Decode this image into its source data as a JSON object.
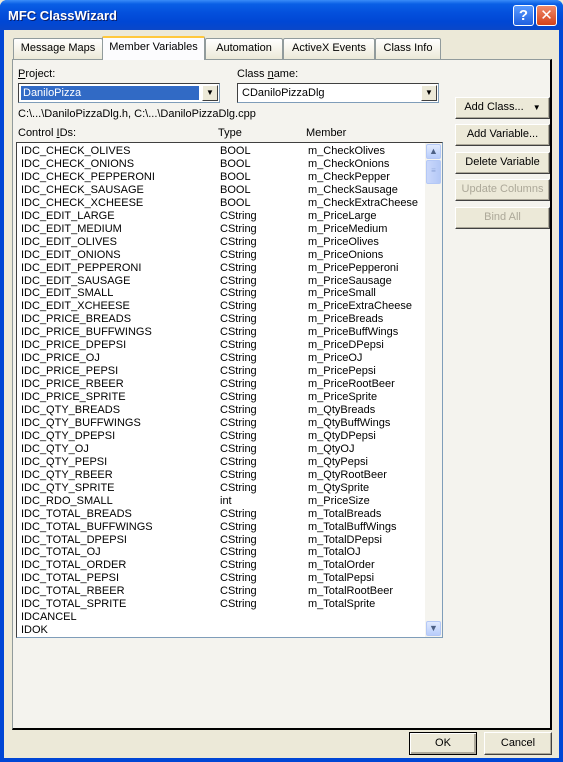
{
  "window": {
    "title": "MFC ClassWizard",
    "help_button": "?",
    "close_button": "✕"
  },
  "tabs": [
    {
      "label": "Message Maps",
      "active": false
    },
    {
      "label": "Member Variables",
      "active": true
    },
    {
      "label": "Automation",
      "active": false
    },
    {
      "label": "ActiveX Events",
      "active": false
    },
    {
      "label": "Class Info",
      "active": false
    }
  ],
  "project": {
    "label_accel": "P",
    "label_rest": "roject:",
    "value": "DaniloPizza"
  },
  "class_name": {
    "label_pre": "Class ",
    "label_accel": "n",
    "label_rest": "ame:",
    "value": "CDaniloPizzaDlg"
  },
  "file_path": "C:\\...\\DaniloPizzaDlg.h, C:\\...\\DaniloPizzaDlg.cpp",
  "list_headers": {
    "control_ids_pre": "Control ",
    "control_ids_accel": "I",
    "control_ids_rest": "Ds:",
    "type": "Type",
    "member": "Member"
  },
  "rows": [
    {
      "id": "IDC_CHECK_OLIVES",
      "type": "BOOL",
      "member": "m_CheckOlives"
    },
    {
      "id": "IDC_CHECK_ONIONS",
      "type": "BOOL",
      "member": "m_CheckOnions"
    },
    {
      "id": "IDC_CHECK_PEPPERONI",
      "type": "BOOL",
      "member": "m_CheckPepper"
    },
    {
      "id": "IDC_CHECK_SAUSAGE",
      "type": "BOOL",
      "member": "m_CheckSausage"
    },
    {
      "id": "IDC_CHECK_XCHEESE",
      "type": "BOOL",
      "member": "m_CheckExtraCheese"
    },
    {
      "id": "IDC_EDIT_LARGE",
      "type": "CString",
      "member": "m_PriceLarge"
    },
    {
      "id": "IDC_EDIT_MEDIUM",
      "type": "CString",
      "member": "m_PriceMedium"
    },
    {
      "id": "IDC_EDIT_OLIVES",
      "type": "CString",
      "member": "m_PriceOlives"
    },
    {
      "id": "IDC_EDIT_ONIONS",
      "type": "CString",
      "member": "m_PriceOnions"
    },
    {
      "id": "IDC_EDIT_PEPPERONI",
      "type": "CString",
      "member": "m_PricePepperoni"
    },
    {
      "id": "IDC_EDIT_SAUSAGE",
      "type": "CString",
      "member": "m_PriceSausage"
    },
    {
      "id": "IDC_EDIT_SMALL",
      "type": "CString",
      "member": "m_PriceSmall"
    },
    {
      "id": "IDC_EDIT_XCHEESE",
      "type": "CString",
      "member": "m_PriceExtraCheese"
    },
    {
      "id": "IDC_PRICE_BREADS",
      "type": "CString",
      "member": "m_PriceBreads"
    },
    {
      "id": "IDC_PRICE_BUFFWINGS",
      "type": "CString",
      "member": "m_PriceBuffWings"
    },
    {
      "id": "IDC_PRICE_DPEPSI",
      "type": "CString",
      "member": "m_PriceDPepsi"
    },
    {
      "id": "IDC_PRICE_OJ",
      "type": "CString",
      "member": "m_PriceOJ"
    },
    {
      "id": "IDC_PRICE_PEPSI",
      "type": "CString",
      "member": "m_PricePepsi"
    },
    {
      "id": "IDC_PRICE_RBEER",
      "type": "CString",
      "member": "m_PriceRootBeer"
    },
    {
      "id": "IDC_PRICE_SPRITE",
      "type": "CString",
      "member": "m_PriceSprite"
    },
    {
      "id": "IDC_QTY_BREADS",
      "type": "CString",
      "member": "m_QtyBreads"
    },
    {
      "id": "IDC_QTY_BUFFWINGS",
      "type": "CString",
      "member": "m_QtyBuffWings"
    },
    {
      "id": "IDC_QTY_DPEPSI",
      "type": "CString",
      "member": "m_QtyDPepsi"
    },
    {
      "id": "IDC_QTY_OJ",
      "type": "CString",
      "member": "m_QtyOJ"
    },
    {
      "id": "IDC_QTY_PEPSI",
      "type": "CString",
      "member": "m_QtyPepsi"
    },
    {
      "id": "IDC_QTY_RBEER",
      "type": "CString",
      "member": "m_QtyRootBeer"
    },
    {
      "id": "IDC_QTY_SPRITE",
      "type": "CString",
      "member": "m_QtySprite"
    },
    {
      "id": "IDC_RDO_SMALL",
      "type": "int",
      "member": "m_PriceSize"
    },
    {
      "id": "IDC_TOTAL_BREADS",
      "type": "CString",
      "member": "m_TotalBreads"
    },
    {
      "id": "IDC_TOTAL_BUFFWINGS",
      "type": "CString",
      "member": "m_TotalBuffWings"
    },
    {
      "id": "IDC_TOTAL_DPEPSI",
      "type": "CString",
      "member": "m_TotalDPepsi"
    },
    {
      "id": "IDC_TOTAL_OJ",
      "type": "CString",
      "member": "m_TotalOJ"
    },
    {
      "id": "IDC_TOTAL_ORDER",
      "type": "CString",
      "member": "m_TotalOrder"
    },
    {
      "id": "IDC_TOTAL_PEPSI",
      "type": "CString",
      "member": "m_TotalPepsi"
    },
    {
      "id": "IDC_TOTAL_RBEER",
      "type": "CString",
      "member": "m_TotalRootBeer"
    },
    {
      "id": "IDC_TOTAL_SPRITE",
      "type": "CString",
      "member": "m_TotalSprite"
    },
    {
      "id": "IDCANCEL",
      "type": "",
      "member": ""
    },
    {
      "id": "IDOK",
      "type": "",
      "member": ""
    }
  ],
  "side_buttons": {
    "add_class": "Add Class...",
    "add_class_arrow": "▼",
    "add_variable": "Add Variable...",
    "delete_variable": "Delete Variable",
    "update_columns": "Update Columns",
    "bind_all": "Bind All"
  },
  "scrollbar": {
    "up_arrow": "︿",
    "down_arrow": "﹀",
    "thumb_grip": "≡"
  },
  "dialog_buttons": {
    "ok": "OK",
    "cancel": "Cancel"
  }
}
